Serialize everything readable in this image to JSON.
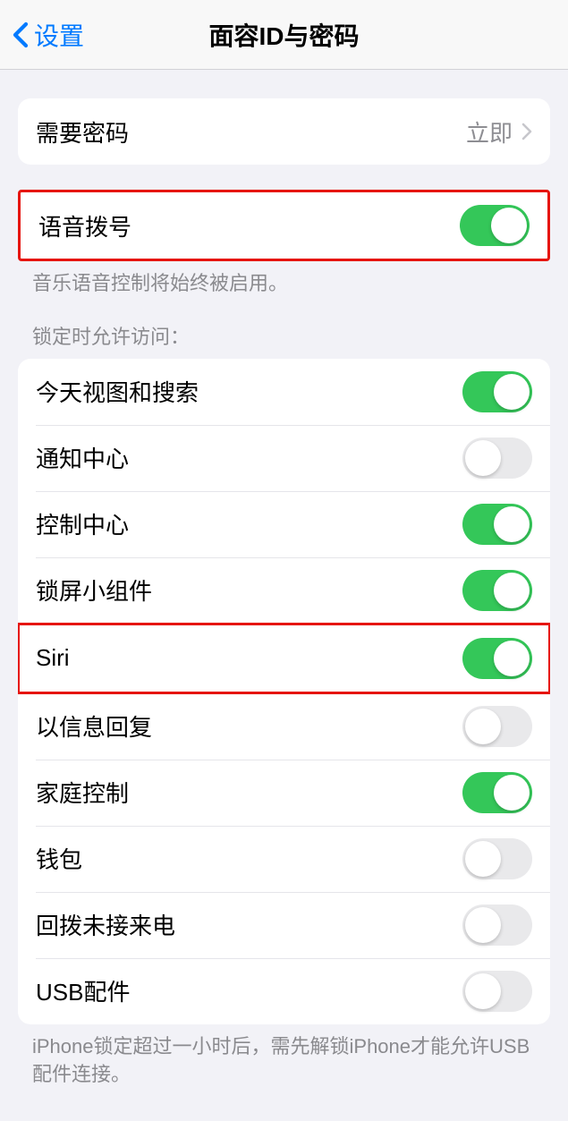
{
  "nav": {
    "back_label": "设置",
    "title": "面容ID与密码"
  },
  "passcode_group": {
    "require_passcode_label": "需要密码",
    "require_passcode_value": "立即"
  },
  "voice_dial_group": {
    "voice_dial_label": "语音拨号",
    "voice_dial_on": true,
    "footer": "音乐语音控制将始终被启用。"
  },
  "locked_access": {
    "header": "锁定时允许访问：",
    "items": [
      {
        "key": "today-search",
        "label": "今天视图和搜索",
        "on": true
      },
      {
        "key": "notification-center",
        "label": "通知中心",
        "on": false
      },
      {
        "key": "control-center",
        "label": "控制中心",
        "on": true
      },
      {
        "key": "lock-screen-widgets",
        "label": "锁屏小组件",
        "on": true
      },
      {
        "key": "siri",
        "label": "Siri",
        "on": true
      },
      {
        "key": "reply-with-message",
        "label": "以信息回复",
        "on": false
      },
      {
        "key": "home-control",
        "label": "家庭控制",
        "on": true
      },
      {
        "key": "wallet",
        "label": "钱包",
        "on": false
      },
      {
        "key": "return-missed-calls",
        "label": "回拨未接来电",
        "on": false
      },
      {
        "key": "usb-accessories",
        "label": "USB配件",
        "on": false
      }
    ],
    "footer": "iPhone锁定超过一小时后，需先解锁iPhone才能允许USB配件连接。"
  }
}
